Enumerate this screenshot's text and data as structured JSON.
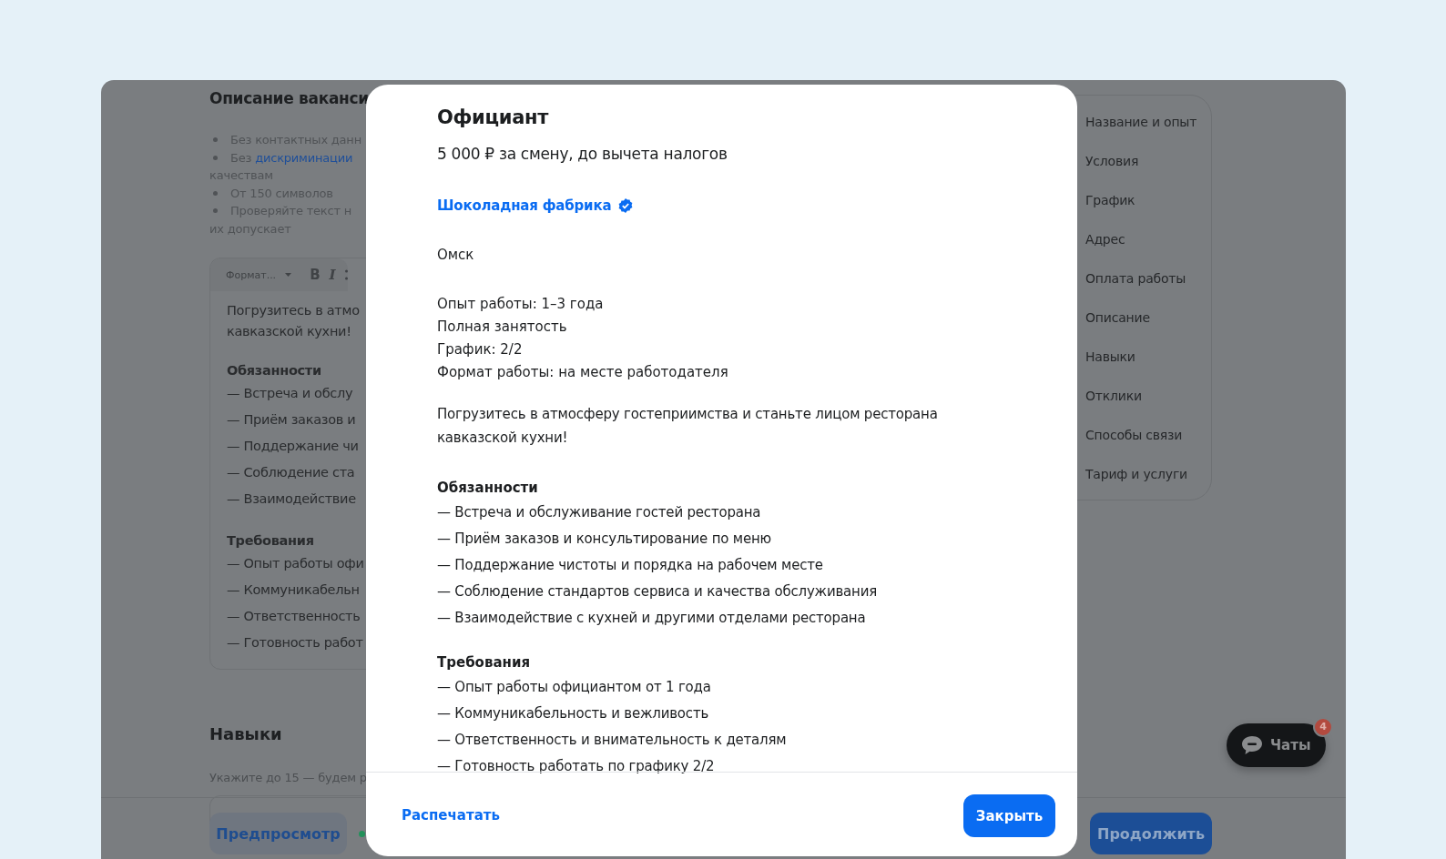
{
  "background": {
    "section_title": "Описание ваканси",
    "rules": [
      {
        "text": "Без контактных данн"
      },
      {
        "text": "Без ",
        "link": "дискриминации",
        "continuation": "качествам"
      },
      {
        "text": "От 150 символов"
      },
      {
        "text": "Проверяйте текст н",
        "continuation": "их допускает"
      }
    ],
    "editor": {
      "format_select": "Формат...",
      "bold_label": "B",
      "italic_label": "I",
      "intro": [
        "Погрузитесь в атмо",
        "кавказской кухни!"
      ],
      "sections": [
        {
          "title": "Обязанности",
          "items": [
            "— Встреча и обслу",
            "— Приём заказов и",
            "— Поддержание чи",
            "— Соблюдение ста",
            "— Взаимодействие"
          ]
        },
        {
          "title": "Требования",
          "items": [
            "— Опыт работы офи",
            "— Коммуникабельн",
            "— Ответственность",
            "— Готовность работ"
          ]
        }
      ]
    },
    "skills_title": "Навыки",
    "skills_hint": "Укажите до 15 — будем р",
    "nav": [
      "Название и опыт",
      "Условия",
      "График",
      "Адрес",
      "Оплата работы",
      "Описание",
      "Навыки",
      "Отклики",
      "Способы связи",
      "Тариф и услуги"
    ],
    "preview_button": "Предпросмотр",
    "continue_button": "Продолжить",
    "chats": {
      "label": "Чаты",
      "badge": "4"
    }
  },
  "modal": {
    "title": "Официант",
    "salary": "5 000 ₽ за смену, до вычета налогов",
    "company": {
      "name": "Шоколадная фабрика",
      "verified": true
    },
    "city": "Омск",
    "details": [
      "Опыт работы: 1–3 года",
      "Полная занятость",
      "График: 2/2",
      "Формат работы: на месте работодателя"
    ],
    "description": "Погрузитесь в атмосферу гостеприимства и станьте лицом ресторана кавказской кухни!",
    "sections": [
      {
        "title": "Обязанности",
        "items": [
          "— Встреча и обслуживание гостей ресторана",
          "— Приём заказов и консультирование по меню",
          "— Поддержание чистоты и порядка на рабочем месте",
          "— Соблюдение стандартов сервиса и качества обслуживания",
          "— Взаимодействие с кухней и другими отделами ресторана"
        ]
      },
      {
        "title": "Требования",
        "items": [
          "— Опыт работы официантом от 1 года",
          "— Коммуникабельность и вежливость",
          "— Ответственность и внимательность к деталям",
          "— Готовность работать по графику 2/2"
        ]
      }
    ],
    "print_link": "Распечатать",
    "close_button": "Закрыть"
  }
}
